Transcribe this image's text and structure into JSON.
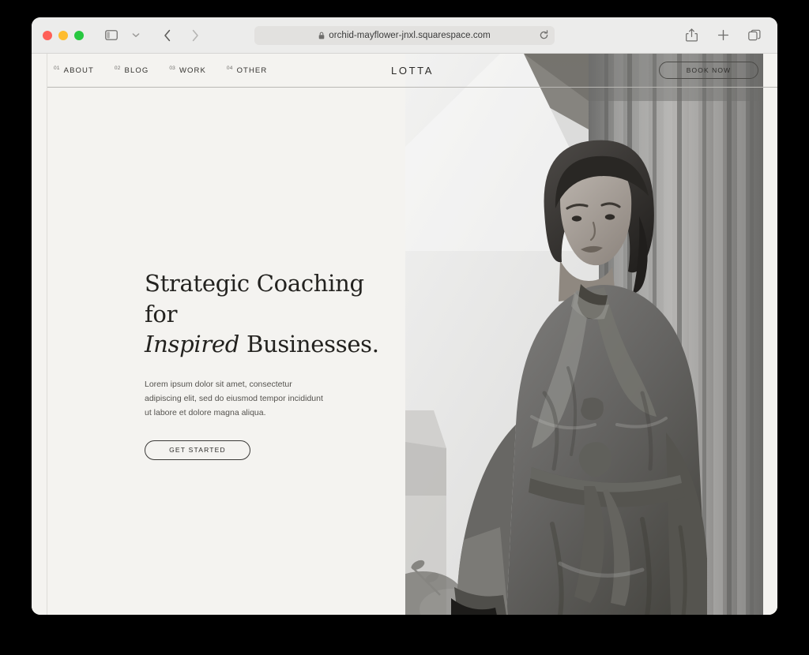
{
  "browser": {
    "name": "Safari",
    "traffic_lights": [
      {
        "name": "close",
        "color": "#ff5f57"
      },
      {
        "name": "minimize",
        "color": "#febc2e"
      },
      {
        "name": "maximize",
        "color": "#28c840"
      }
    ],
    "sidebar_toggle_icon": "sidebar-icon",
    "sidebar_dropdown_icon": "chevron-down-icon",
    "back_icon": "chevron-left-icon",
    "forward_icon": "chevron-right-icon",
    "address": {
      "url": "orchid-mayflower-jnxl.squarespace.com",
      "lock_icon": "lock-icon",
      "reload_icon": "reload-icon",
      "placeholder": "Search or enter website name"
    },
    "actions": [
      {
        "name": "share-icon",
        "label": "Share"
      },
      {
        "name": "new-tab-icon",
        "label": "New Tab"
      },
      {
        "name": "tab-overview-icon",
        "label": "Show Tab Overview"
      }
    ]
  },
  "site": {
    "brand": "LOTTA",
    "nav": [
      {
        "number": "01",
        "label": "ABOUT"
      },
      {
        "number": "02",
        "label": "BLOG"
      },
      {
        "number": "03",
        "label": "WORK"
      },
      {
        "number": "04",
        "label": "OTHER"
      }
    ],
    "book_button": "BOOK NOW",
    "hero": {
      "headline_line1": "Strategic Coaching for",
      "headline_emphasis": "Inspired",
      "headline_line2_rest": " Businesses.",
      "body": "Lorem ipsum dolor sit amet, consectetur adipiscing elit, sed do eiusmod tempor incididunt ut labore et dolore magna aliqua.",
      "cta": "GET STARTED",
      "image_alt": "Black and white photo of a woman in a belted wrap coat standing before classical fluted columns"
    },
    "colors": {
      "background": "#f4f3f0",
      "text": "#23221f",
      "muted_text": "#55534f",
      "rule": "#b9b8b4"
    }
  }
}
